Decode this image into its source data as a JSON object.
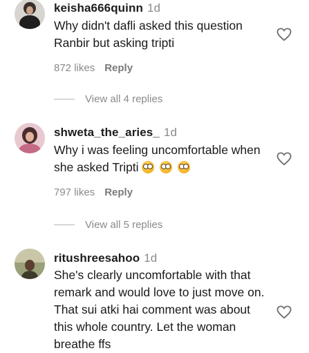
{
  "comments": [
    {
      "username": "keisha666quinn",
      "time": "1d",
      "text": "Why didn't dafli asked this question Ranbir but asking tripti",
      "likes": "872 likes",
      "reply_label": "Reply",
      "view_replies": "View all 4 replies"
    },
    {
      "username": "shweta_the_aries_",
      "time": "1d",
      "text": "Why i was feeling uncomfortable when she asked Tripti",
      "emoji_icons": [
        "flushed-face-icon",
        "flushed-face-icon",
        "flushed-face-icon"
      ],
      "likes": "797 likes",
      "reply_label": "Reply",
      "view_replies": "View all 5 replies"
    },
    {
      "username": "ritushreesahoo",
      "time": "1d",
      "text": "She's clearly uncomfortable with that remark and would love to just move on. That sui atki hai comment was about this whole country. Let the woman breathe ffs"
    }
  ]
}
